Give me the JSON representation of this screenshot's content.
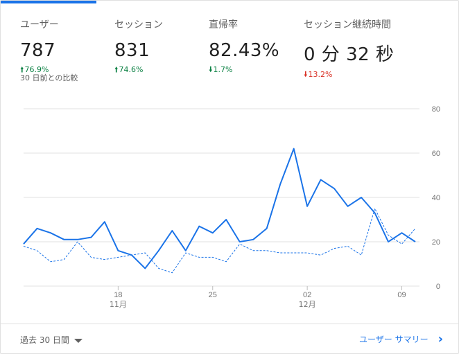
{
  "metrics": [
    {
      "label": "ユーザー",
      "value": "787",
      "change": "76.9%",
      "direction": "up"
    },
    {
      "label": "セッション",
      "value": "831",
      "change": "74.6%",
      "direction": "up"
    },
    {
      "label": "直帰率",
      "value": "82.43%",
      "change": "1.7%",
      "direction": "down"
    },
    {
      "label": "セッション継続時間",
      "value": "0 分 32 秒",
      "change": "13.2%",
      "direction": "down"
    }
  ],
  "comparison_label": "30 日前との比較",
  "footer": {
    "date_range": "過去 30 日間",
    "report_link": "ユーザー サマリー"
  },
  "colors": {
    "accent": "#1a73e8",
    "positive": "#0b8043",
    "negative": "#d93025"
  },
  "icons": {
    "up": "arrow-up-icon",
    "down": "arrow-down-icon",
    "dropdown": "caret-down-icon",
    "link": "chevron-right-icon"
  },
  "chart_data": {
    "type": "line",
    "x_ticks": [
      {
        "label": "18",
        "sublabel": "11月",
        "index": 7
      },
      {
        "label": "25",
        "sublabel": "",
        "index": 14
      },
      {
        "label": "02",
        "sublabel": "12月",
        "index": 21
      },
      {
        "label": "09",
        "sublabel": "",
        "index": 28
      }
    ],
    "ylim": [
      0,
      80
    ],
    "y_ticks": [
      0,
      20,
      40,
      60,
      80
    ],
    "grid": true,
    "series": [
      {
        "style": "solid",
        "values": [
          19,
          26,
          24,
          21,
          21,
          22,
          29,
          16,
          14,
          8,
          16,
          25,
          16,
          27,
          24,
          30,
          20,
          21,
          26,
          46,
          62,
          36,
          48,
          44,
          36,
          40,
          33,
          20,
          24,
          20
        ]
      },
      {
        "style": "dashed",
        "values": [
          18,
          16,
          11,
          12,
          20,
          13,
          12,
          13,
          14,
          15,
          8,
          6,
          15,
          13,
          13,
          11,
          19,
          16,
          16,
          15,
          15,
          15,
          14,
          17,
          18,
          14,
          35,
          23,
          19,
          26
        ]
      }
    ]
  }
}
